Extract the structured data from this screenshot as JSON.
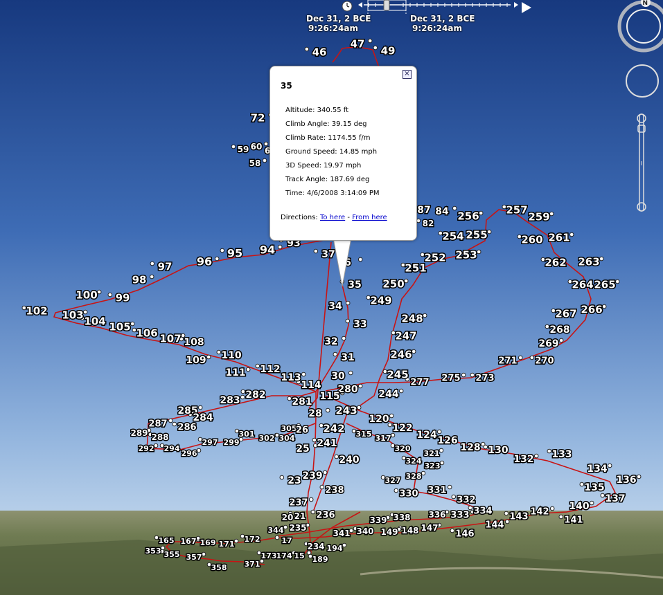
{
  "time_slider": {
    "start": {
      "date": "Dec 31, 2 BCE",
      "time": "9:26:24am"
    },
    "end": {
      "date": "Dec 31, 2 BCE",
      "time": "9:26:24am"
    },
    "icons": [
      "clock-icon",
      "play-icon"
    ]
  },
  "navigation": {
    "compass_letter": "N",
    "icons": [
      "compass-icon",
      "look-joystick-icon",
      "zoom-slider-icon"
    ]
  },
  "balloon": {
    "title": "35",
    "fields": [
      "Altitude: 340.55 ft",
      "Climb Angle: 39.15 deg",
      "Climb Rate: 1174.55 f/m",
      "Ground Speed: 14.85 mph",
      "3D Speed: 19.97 mph",
      "Track Angle: 187.69 deg",
      "Time: 4/6/2008 3:14:09 PM"
    ],
    "directions_label": "Directions:",
    "to_here": "To here",
    "separator": "-",
    "from_here": "From here",
    "close_icon": "close-icon"
  },
  "colors": {
    "sky_top": "#1c3f8a",
    "sky_bottom": "#8fb2dc",
    "track": "#c81414",
    "label_fill": "#ffffff",
    "label_stroke": "#000000",
    "ground": "#6e7a55"
  },
  "track_labels": [
    "46",
    "47",
    "49",
    "72",
    "59",
    "60",
    "6",
    "58",
    "35",
    "34",
    "33",
    "32",
    "31",
    "30",
    "37",
    "6",
    "87",
    "84",
    "82",
    "256",
    "257",
    "259",
    "254",
    "255",
    "252",
    "253",
    "251",
    "250",
    "249",
    "248",
    "247",
    "246",
    "245",
    "244",
    "260",
    "261",
    "262",
    "263",
    "264",
    "265",
    "267",
    "266",
    "268",
    "269",
    "270",
    "271",
    "273",
    "275",
    "277",
    "280",
    "93",
    "94",
    "95",
    "96",
    "97",
    "98",
    "99",
    "100",
    "102",
    "103",
    "104",
    "105",
    "106",
    "107",
    "108",
    "109",
    "110",
    "111",
    "112",
    "113",
    "114",
    "115",
    "281",
    "283",
    "282",
    "285",
    "284",
    "287",
    "286",
    "289",
    "288",
    "292",
    "294",
    "296",
    "297",
    "299",
    "301",
    "302",
    "304",
    "305",
    "26",
    "28",
    "242",
    "243",
    "241",
    "25",
    "240",
    "120",
    "122",
    "124",
    "126",
    "128",
    "130",
    "132",
    "133",
    "134",
    "135",
    "136",
    "137",
    "140",
    "141",
    "142",
    "143",
    "144",
    "146",
    "147",
    "148",
    "149",
    "315",
    "317",
    "320",
    "321",
    "324",
    "323",
    "327",
    "328",
    "330",
    "331",
    "332",
    "333",
    "334",
    "336",
    "338",
    "339",
    "340",
    "341",
    "23",
    "239",
    "238",
    "237",
    "236",
    "20",
    "21",
    "235",
    "234",
    "344",
    "17",
    "15",
    "172",
    "171",
    "169",
    "167",
    "165",
    "353",
    "355",
    "357",
    "358",
    "371",
    "173",
    "174",
    "189",
    "194"
  ]
}
